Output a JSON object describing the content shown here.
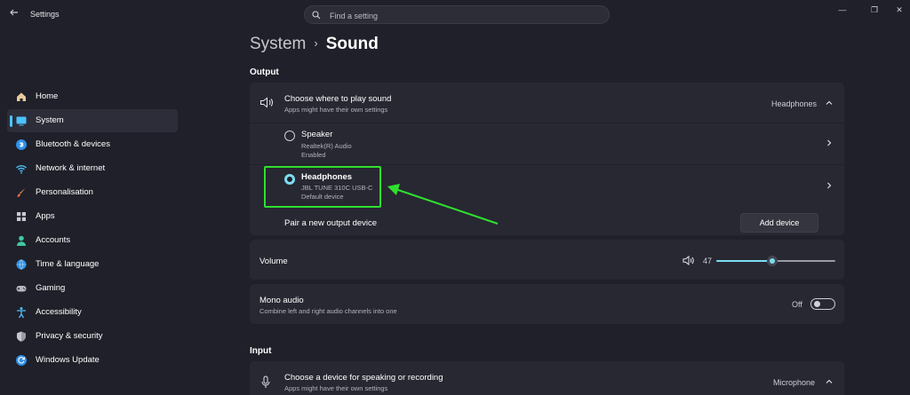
{
  "window": {
    "title": "Settings",
    "controls": {
      "minimize": "—",
      "maximize": "❐",
      "close": "✕"
    }
  },
  "search": {
    "placeholder": "Find a setting"
  },
  "sidebar": {
    "items": [
      {
        "label": "Home",
        "icon": "home-icon"
      },
      {
        "label": "System",
        "icon": "system-icon",
        "active": true
      },
      {
        "label": "Bluetooth & devices",
        "icon": "bluetooth-icon"
      },
      {
        "label": "Network & internet",
        "icon": "wifi-icon"
      },
      {
        "label": "Personalisation",
        "icon": "brush-icon"
      },
      {
        "label": "Apps",
        "icon": "apps-icon"
      },
      {
        "label": "Accounts",
        "icon": "person-icon"
      },
      {
        "label": "Time & language",
        "icon": "globe-clock-icon"
      },
      {
        "label": "Gaming",
        "icon": "gamepad-icon"
      },
      {
        "label": "Accessibility",
        "icon": "accessibility-icon"
      },
      {
        "label": "Privacy & security",
        "icon": "shield-icon"
      },
      {
        "label": "Windows Update",
        "icon": "update-icon"
      }
    ]
  },
  "breadcrumb": {
    "parent": "System",
    "separator": "›",
    "current": "Sound"
  },
  "output": {
    "heading": "Output",
    "choose": {
      "title": "Choose where to play sound",
      "subtitle": "Apps might have their own settings",
      "selected": "Headphones"
    },
    "devices": [
      {
        "name": "Speaker",
        "detail": "Realtek(R) Audio",
        "status": "Enabled",
        "checked": false
      },
      {
        "name": "Headphones",
        "detail": "JBL TUNE 310C USB-C",
        "status": "Default device",
        "checked": true
      }
    ],
    "pair": {
      "label": "Pair a new output device",
      "button": "Add device"
    },
    "volume": {
      "label": "Volume",
      "value": 47
    },
    "mono": {
      "title": "Mono audio",
      "subtitle": "Combine left and right audio channels into one",
      "state": "Off"
    }
  },
  "input": {
    "heading": "Input",
    "choose": {
      "title": "Choose a device for speaking or recording",
      "subtitle": "Apps might have their own settings",
      "selected": "Microphone"
    }
  },
  "colors": {
    "background": "#1f2029",
    "card": "#272832",
    "accent": "#7ddcf0",
    "highlight": "#2fe02f"
  }
}
